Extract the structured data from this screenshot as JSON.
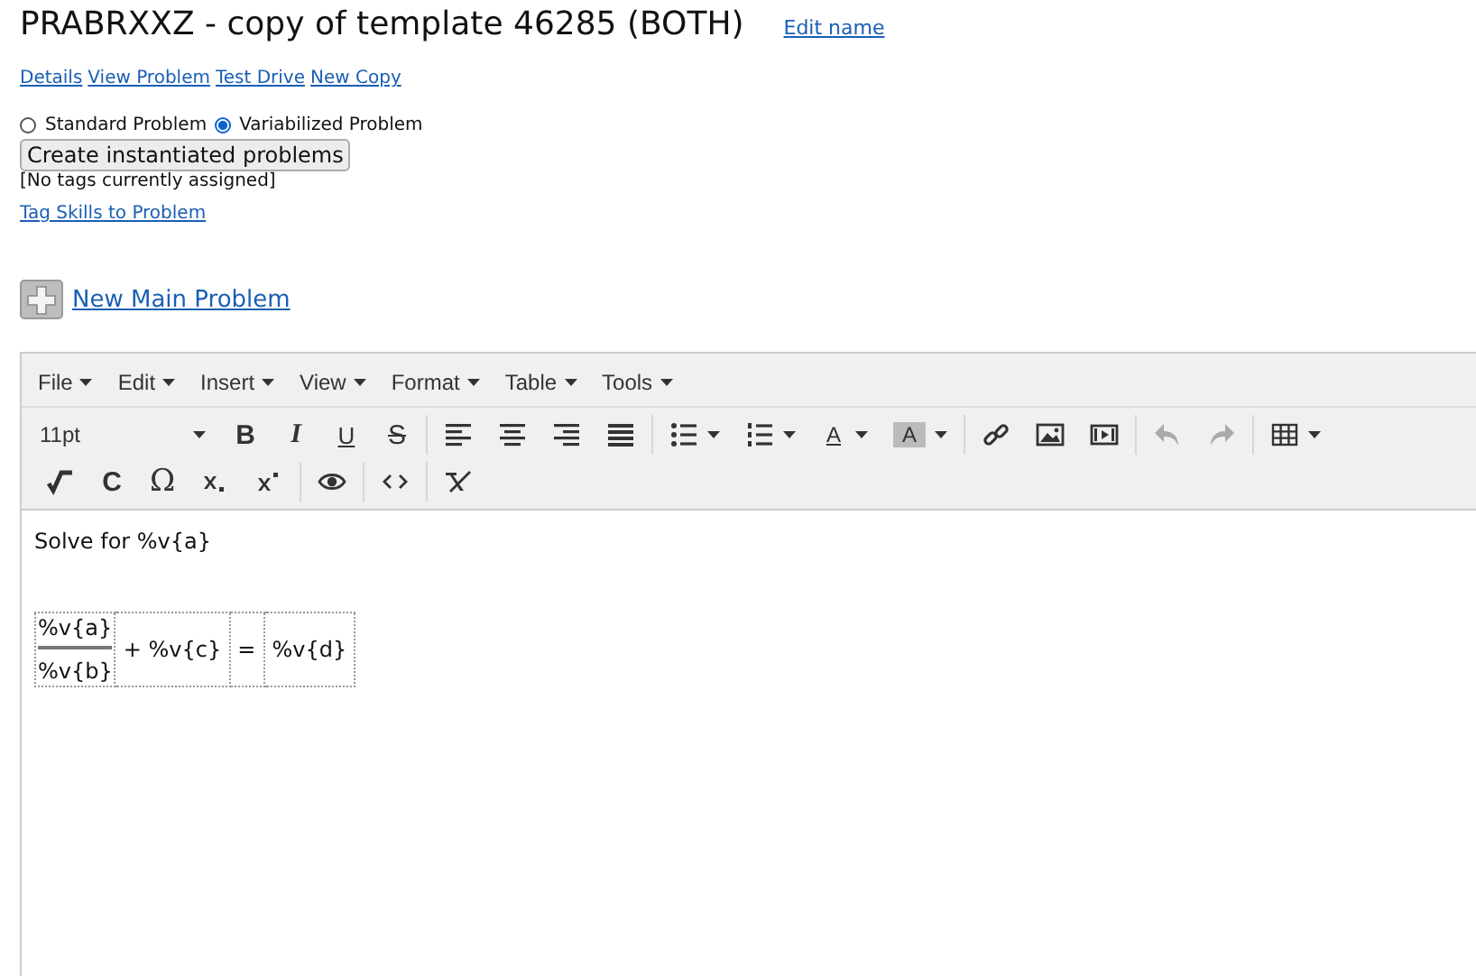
{
  "title": "PRABRXXZ - copy of template 46285 (BOTH)",
  "edit_link": "Edit name",
  "nav_links": [
    "Details",
    "View Problem",
    "Test Drive",
    "New Copy"
  ],
  "problem_types": [
    {
      "label": "Standard Problem",
      "selected": false
    },
    {
      "label": "Variabilized Problem",
      "selected": true
    }
  ],
  "create_button": "Create instantiated problems",
  "tags_note": "[No tags currently assigned]",
  "tag_link": "Tag Skills to Problem",
  "new_problem_link": "New Main Problem",
  "editor": {
    "menus": [
      "File",
      "Edit",
      "Insert",
      "View",
      "Format",
      "Table",
      "Tools"
    ],
    "font_size": "11pt",
    "toolbar_rows": [
      [
        {
          "kind": "bold",
          "text": "B"
        },
        {
          "kind": "italic",
          "text": "I"
        },
        {
          "kind": "underline",
          "text": "U"
        },
        {
          "kind": "strike",
          "text": "S"
        },
        {
          "kind": "sep"
        },
        {
          "kind": "alignleft"
        },
        {
          "kind": "aligncenter"
        },
        {
          "kind": "alignright"
        },
        {
          "kind": "justify"
        },
        {
          "kind": "sep"
        },
        {
          "kind": "bullets",
          "caret": true
        },
        {
          "kind": "numbers",
          "caret": true
        },
        {
          "kind": "forecolor",
          "text": "A",
          "caret": true
        },
        {
          "kind": "backcolor",
          "text": "A",
          "caret": true
        },
        {
          "kind": "sep"
        },
        {
          "kind": "link"
        },
        {
          "kind": "image"
        },
        {
          "kind": "media"
        },
        {
          "kind": "sep"
        },
        {
          "kind": "undo",
          "disabled": true
        },
        {
          "kind": "redo",
          "disabled": true
        },
        {
          "kind": "sep"
        },
        {
          "kind": "grid",
          "caret": true
        }
      ],
      [
        {
          "kind": "root"
        },
        {
          "kind": "bold",
          "text": "C"
        },
        {
          "kind": "symbol",
          "text": "Ω"
        },
        {
          "kind": "sub"
        },
        {
          "kind": "sup"
        },
        {
          "kind": "sep"
        },
        {
          "kind": "eye"
        },
        {
          "kind": "sep"
        },
        {
          "kind": "code"
        },
        {
          "kind": "sep"
        },
        {
          "kind": "clear"
        }
      ]
    ],
    "content": {
      "sentence": "Solve for %v{a}",
      "equation": {
        "numerator": "%v{a}",
        "denominator": "%v{b}",
        "cells": [
          "+ %v{c}",
          "=",
          "%v{d}"
        ]
      }
    }
  }
}
